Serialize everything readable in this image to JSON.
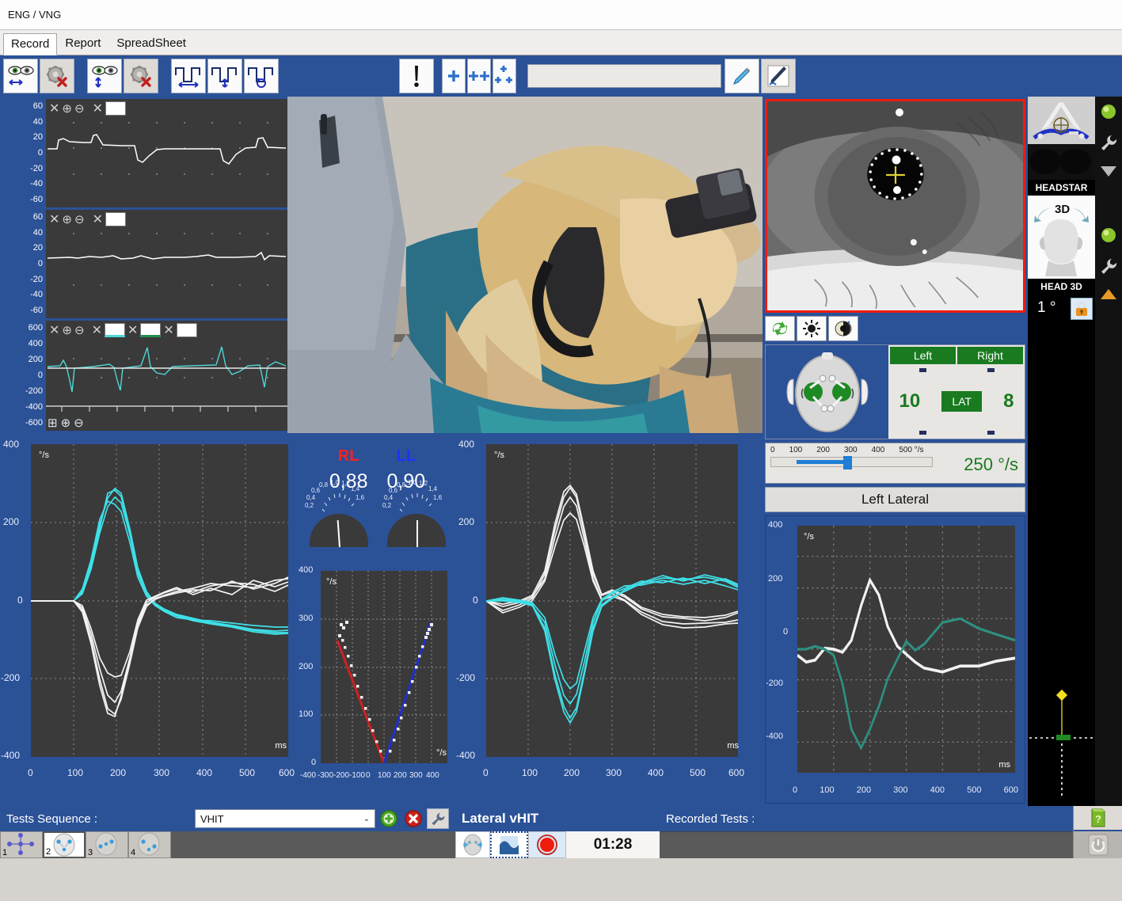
{
  "window": {
    "title": "ENG / VNG"
  },
  "tabs": [
    {
      "label": "Record",
      "active": true
    },
    {
      "label": "Report",
      "active": false
    },
    {
      "label": "SpreadSheet",
      "active": false
    }
  ],
  "toolbar": {
    "icons": [
      "eyes-horizontal-icon",
      "gear-disable-icon",
      "eyes-vertical-icon",
      "gear-disable-torsion-icon",
      "calib-horizontal-icon",
      "calib-vertical-icon",
      "calib-torsion-icon"
    ],
    "alert_icon": "exclamation-icon",
    "marker_icons": [
      "add-marker-icon",
      "add-markers-icon",
      "add-all-markers-icon"
    ],
    "note_value": "",
    "note_placeholder": "",
    "pen_icon": "highlighter-icon",
    "edit_icon": "pen-edit-icon"
  },
  "traces": [
    {
      "name": "horizontal-eye-trace",
      "ticks": [
        "60",
        "40",
        "20",
        "0",
        "-20",
        "-40",
        "-60"
      ]
    },
    {
      "name": "vertical-eye-trace",
      "ticks": [
        "60",
        "40",
        "20",
        "0",
        "-20",
        "-40",
        "-60"
      ]
    },
    {
      "name": "velocity-trace",
      "ticks": [
        "600",
        "400",
        "200",
        "0",
        "-200",
        "-400",
        "-600"
      ]
    }
  ],
  "gains": {
    "right_label": "RL",
    "right_value": "0,88",
    "right_color": "#ff2020",
    "left_label": "LL",
    "left_value": "0,90",
    "left_color": "#2030ff",
    "gauge_ticks": [
      "0,2",
      "0,4",
      "0,6",
      "0,8",
      "1,0",
      "1,2",
      "1,4",
      "1,6"
    ]
  },
  "head": {
    "left_header": "Left",
    "right_header": "Right",
    "left_count": "10",
    "right_count": "8",
    "lat_label": "LAT",
    "speed_ticks": [
      "0",
      "100",
      "200",
      "300",
      "400",
      "500 °/s"
    ],
    "speed_value": "250 °/s",
    "test_name": "Left Lateral"
  },
  "sidebar": {
    "headstar_label": "HEADSTAR",
    "head3d_label": "HEAD 3D",
    "head3d_badge": "3D",
    "angle_value": "1 °",
    "lock_icon": "lock-icon",
    "status_icons": [
      "green-led-icon",
      "wrench-icon",
      "gray-triangle-icon",
      "green-led-icon",
      "wrench-icon",
      "orange-triangle-icon"
    ]
  },
  "bottom": {
    "sequence_label": "Tests Sequence :",
    "sequence_value": "VHIT",
    "add_icon": "add-green-icon",
    "remove_icon": "remove-red-icon",
    "settings_icon": "wrench-icon",
    "thumbs": [
      "1",
      "2",
      "3",
      "4"
    ],
    "selected_thumb": "2",
    "test_title": "Lateral vHIT",
    "timer": "01:28",
    "recorded_label": "Recorded Tests :",
    "head_icon": "head-target-icon",
    "view_icon": "view-image-icon",
    "record_icon": "record-button-icon",
    "help_icon": "help-book-icon",
    "power_icon": "power-icon"
  },
  "chart_data": [
    {
      "name": "left-vhit-overlay",
      "type": "line",
      "title": "",
      "xlabel": "ms",
      "ylabel": "°/s",
      "xlim": [
        0,
        600
      ],
      "ylim": [
        -400,
        400
      ],
      "grid": true,
      "xticks": [
        0,
        100,
        200,
        300,
        400,
        500,
        600
      ],
      "yticks": [
        -400,
        -200,
        0,
        200,
        400
      ],
      "series": [
        {
          "name": "head-velocity",
          "color": "#3fe0e8",
          "x": [
            0,
            50,
            100,
            120,
            140,
            160,
            180,
            195,
            210,
            230,
            250,
            270,
            290,
            310,
            340,
            380,
            420,
            470,
            520,
            570,
            600
          ],
          "values": [
            0,
            0,
            0,
            25,
            95,
            195,
            265,
            288,
            275,
            185,
            85,
            25,
            -5,
            -20,
            -35,
            -45,
            -55,
            -62,
            -68,
            -72,
            -75
          ]
        },
        {
          "name": "head-velocity-2",
          "color": "#3fe0e8",
          "x": [
            0,
            50,
            100,
            120,
            140,
            160,
            180,
            195,
            210,
            230,
            250,
            270,
            290,
            310,
            340,
            380,
            420,
            470,
            520,
            570,
            600
          ],
          "values": [
            0,
            0,
            0,
            18,
            80,
            175,
            240,
            262,
            250,
            170,
            70,
            18,
            -10,
            -25,
            -38,
            -50,
            -58,
            -66,
            -70,
            -78,
            -82
          ]
        },
        {
          "name": "head-velocity-3",
          "color": "#3fe0e8",
          "x": [
            0,
            50,
            100,
            120,
            140,
            160,
            180,
            195,
            210,
            230,
            250,
            270,
            290,
            310,
            340,
            380,
            420,
            470,
            520,
            570,
            600
          ],
          "values": [
            0,
            0,
            0,
            30,
            105,
            210,
            255,
            250,
            230,
            150,
            60,
            10,
            -12,
            -28,
            -42,
            -48,
            -50,
            -55,
            -60,
            -64,
            -66
          ]
        },
        {
          "name": "eye-velocity",
          "color": "#f2f2f2",
          "x": [
            0,
            50,
            100,
            120,
            140,
            160,
            180,
            195,
            210,
            230,
            250,
            270,
            290,
            310,
            340,
            380,
            420,
            470,
            520,
            570,
            600
          ],
          "values": [
            0,
            0,
            0,
            -25,
            -100,
            -200,
            -275,
            -290,
            -250,
            -160,
            -70,
            -15,
            5,
            15,
            25,
            35,
            45,
            40,
            35,
            45,
            55
          ]
        },
        {
          "name": "eye-velocity-2",
          "color": "#f2f2f2",
          "x": [
            0,
            50,
            100,
            120,
            140,
            160,
            180,
            195,
            210,
            230,
            250,
            270,
            290,
            310,
            340,
            380,
            420,
            470,
            520,
            570,
            600
          ],
          "values": [
            0,
            0,
            0,
            -18,
            -85,
            -175,
            -240,
            -258,
            -230,
            -145,
            -55,
            -5,
            10,
            20,
            30,
            42,
            38,
            48,
            42,
            30,
            40
          ]
        },
        {
          "name": "eye-velocity-3",
          "color": "#f2f2f2",
          "x": [
            0,
            50,
            100,
            120,
            140,
            160,
            180,
            195,
            210,
            230,
            250,
            270,
            290,
            310,
            340,
            380,
            420,
            470,
            520,
            570,
            600
          ],
          "values": [
            0,
            0,
            0,
            -12,
            -70,
            -145,
            -185,
            -195,
            -190,
            -130,
            -50,
            0,
            12,
            22,
            35,
            30,
            42,
            32,
            45,
            38,
            48
          ]
        }
      ]
    },
    {
      "name": "gain-regression-scatter",
      "type": "scatter",
      "title": "",
      "xlabel": "°/s",
      "ylabel": "°/s",
      "xlim": [
        -400,
        400
      ],
      "ylim": [
        0,
        400
      ],
      "grid": true,
      "xticks": [
        -400,
        -300,
        -200,
        -100,
        0,
        100,
        200,
        300,
        400
      ],
      "yticks": [
        0,
        100,
        200,
        300,
        400
      ],
      "series": [
        {
          "name": "rightward-fit",
          "color": "#d02020",
          "slope": -0.88,
          "points_x": [
            -30,
            -60,
            -90,
            -120,
            -150,
            -180,
            -210,
            -240,
            -265,
            -285,
            -300,
            -305
          ],
          "points_y": [
            28,
            58,
            88,
            112,
            140,
            165,
            190,
            215,
            240,
            255,
            268,
            272
          ]
        },
        {
          "name": "leftward-fit",
          "color": "#2030cc",
          "slope": 0.9,
          "points_x": [
            25,
            55,
            85,
            115,
            150,
            185,
            215,
            250,
            275,
            295,
            305,
            310
          ],
          "points_y": [
            30,
            60,
            90,
            118,
            148,
            180,
            205,
            240,
            262,
            278,
            288,
            292
          ]
        }
      ]
    },
    {
      "name": "right-vhit-overlay",
      "type": "line",
      "title": "",
      "xlabel": "ms",
      "ylabel": "°/s",
      "xlim": [
        0,
        600
      ],
      "ylim": [
        -400,
        400
      ],
      "grid": true,
      "xticks": [
        0,
        100,
        200,
        300,
        400,
        500,
        600
      ],
      "yticks": [
        -400,
        -200,
        0,
        200,
        400
      ],
      "series": [
        {
          "name": "head-velocity",
          "color": "#f2f2f2",
          "x": [
            0,
            40,
            80,
            110,
            140,
            165,
            185,
            200,
            215,
            235,
            255,
            275,
            300,
            330,
            370,
            420,
            470,
            520,
            570,
            600
          ],
          "values": [
            0,
            -25,
            -10,
            5,
            70,
            185,
            265,
            290,
            265,
            175,
            70,
            15,
            25,
            10,
            -20,
            -40,
            -45,
            -50,
            -42,
            -30
          ]
        },
        {
          "name": "head-velocity-2",
          "color": "#f2f2f2",
          "x": [
            0,
            40,
            80,
            110,
            140,
            165,
            185,
            200,
            215,
            235,
            255,
            275,
            300,
            330,
            370,
            420,
            470,
            520,
            570,
            600
          ],
          "values": [
            0,
            -15,
            -5,
            10,
            60,
            165,
            240,
            262,
            245,
            160,
            60,
            5,
            18,
            5,
            -28,
            -52,
            -60,
            -58,
            -55,
            -50
          ]
        },
        {
          "name": "head-velocity-3",
          "color": "#f2f2f2",
          "x": [
            0,
            40,
            80,
            110,
            140,
            165,
            185,
            200,
            215,
            235,
            255,
            275,
            300,
            330,
            370,
            420,
            470,
            520,
            570,
            600
          ],
          "values": [
            0,
            -30,
            -15,
            0,
            50,
            140,
            205,
            225,
            215,
            140,
            50,
            0,
            12,
            0,
            -35,
            -62,
            -70,
            -68,
            -60,
            -58
          ]
        },
        {
          "name": "eye-velocity",
          "color": "#3fe0e8",
          "x": [
            0,
            40,
            80,
            110,
            140,
            165,
            185,
            200,
            215,
            235,
            255,
            275,
            300,
            330,
            370,
            420,
            470,
            520,
            570,
            600
          ],
          "values": [
            0,
            5,
            0,
            -8,
            -70,
            -190,
            -270,
            -300,
            -275,
            -180,
            -70,
            -10,
            10,
            25,
            45,
            60,
            55,
            62,
            50,
            35
          ]
        },
        {
          "name": "eye-velocity-2",
          "color": "#3fe0e8",
          "x": [
            0,
            40,
            80,
            110,
            140,
            165,
            185,
            200,
            215,
            235,
            255,
            275,
            300,
            330,
            370,
            420,
            470,
            520,
            570,
            600
          ],
          "values": [
            0,
            0,
            -5,
            -12,
            -55,
            -165,
            -240,
            -262,
            -240,
            -155,
            -55,
            0,
            18,
            32,
            52,
            48,
            58,
            45,
            55,
            42
          ]
        },
        {
          "name": "eye-velocity-3",
          "color": "#3fe0e8",
          "x": [
            0,
            40,
            80,
            110,
            140,
            165,
            185,
            200,
            215,
            235,
            255,
            275,
            300,
            330,
            370,
            420,
            470,
            520,
            570,
            600
          ],
          "values": [
            0,
            8,
            2,
            -5,
            -45,
            -140,
            -200,
            -225,
            -210,
            -130,
            -45,
            5,
            22,
            38,
            40,
            52,
            42,
            50,
            38,
            28
          ]
        }
      ]
    },
    {
      "name": "single-trial-chart",
      "type": "line",
      "title": "",
      "xlabel": "ms",
      "ylabel": "°/s",
      "xlim": [
        0,
        600
      ],
      "ylim": [
        -400,
        400
      ],
      "grid": true,
      "xticks": [
        0,
        100,
        200,
        300,
        400,
        500,
        600
      ],
      "yticks": [
        -400,
        -200,
        0,
        200,
        400
      ],
      "series": [
        {
          "name": "head-velocity",
          "color": "#f2f2f2",
          "x": [
            0,
            25,
            50,
            75,
            100,
            125,
            150,
            175,
            200,
            225,
            250,
            275,
            300,
            325,
            350,
            400,
            450,
            500,
            550,
            600
          ],
          "values": [
            -20,
            -42,
            -35,
            5,
            0,
            -5,
            30,
            140,
            225,
            175,
            75,
            5,
            -15,
            -40,
            -60,
            -75,
            -70,
            -55,
            -40,
            -30
          ]
        },
        {
          "name": "eye-velocity",
          "color": "#2f8f7f",
          "x": [
            0,
            25,
            50,
            75,
            100,
            125,
            150,
            175,
            200,
            225,
            250,
            275,
            300,
            325,
            350,
            400,
            450,
            500,
            550,
            600
          ],
          "values": [
            0,
            0,
            5,
            0,
            -10,
            -55,
            -130,
            -205,
            -258,
            -185,
            -95,
            -30,
            25,
            5,
            15,
            75,
            85,
            68,
            55,
            30
          ]
        }
      ]
    }
  ]
}
